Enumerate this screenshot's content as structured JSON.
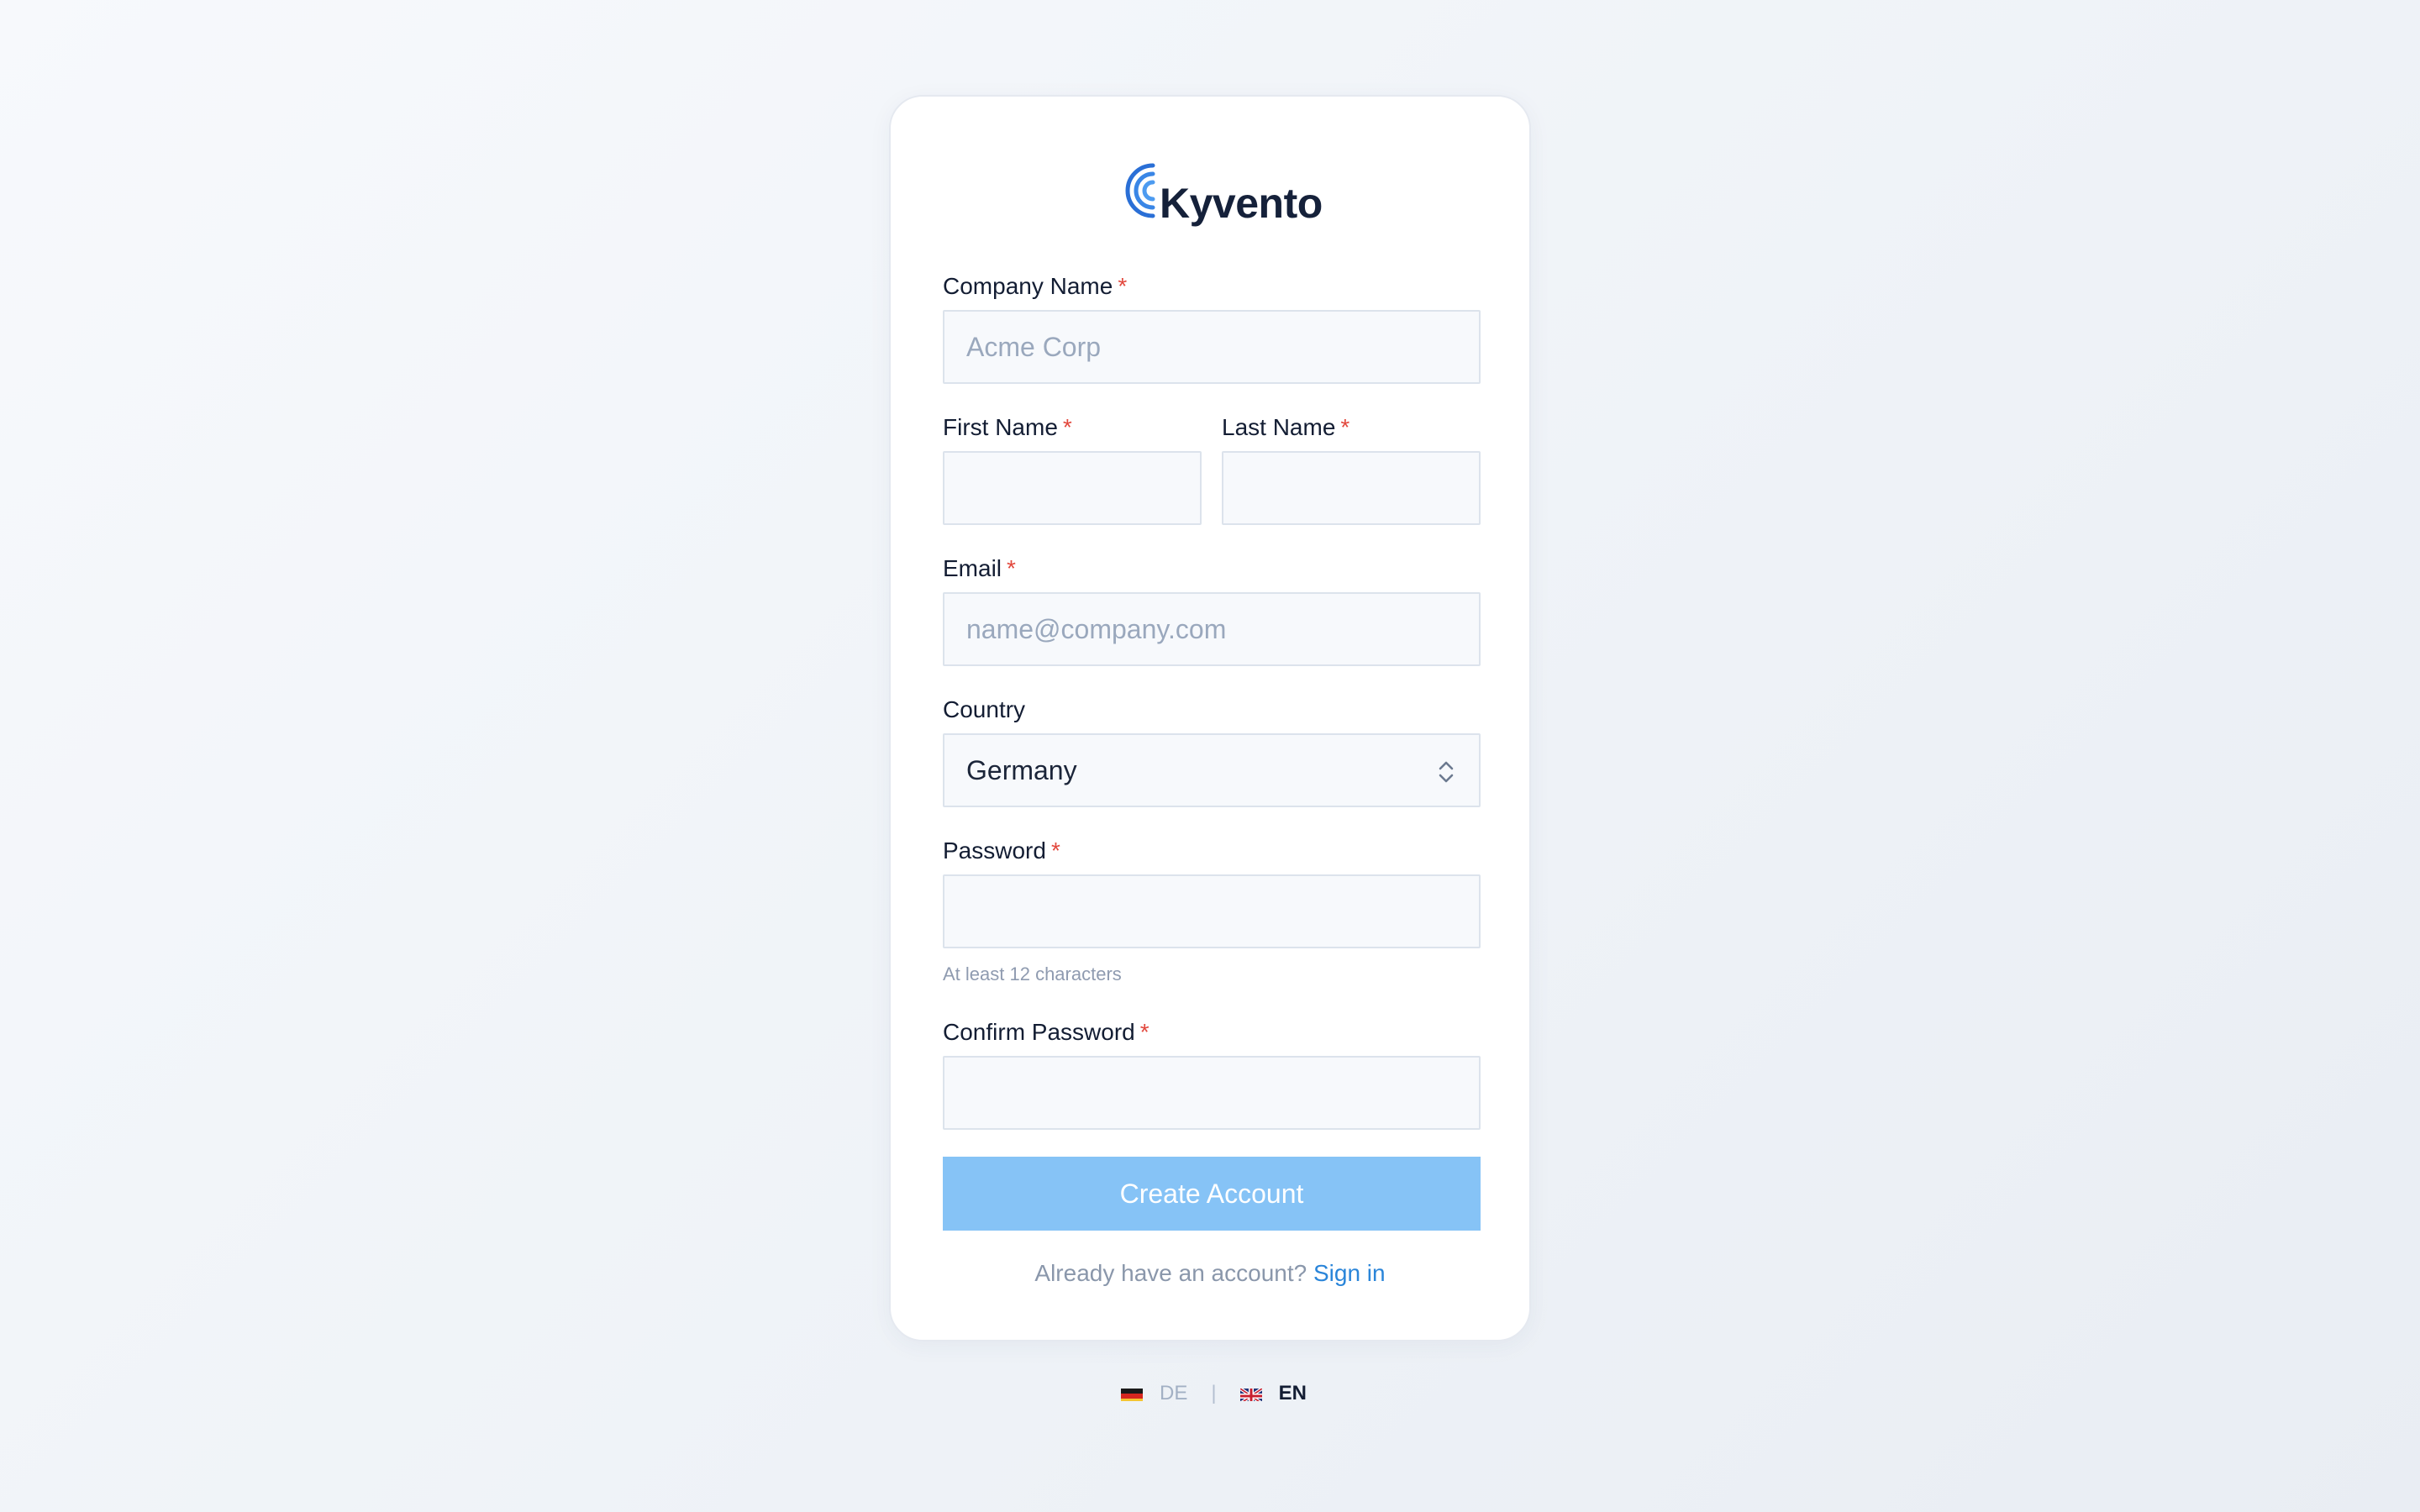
{
  "brand": {
    "name": "Kyvento",
    "accent_color": "#2a6fd6"
  },
  "form": {
    "company": {
      "label": "Company Name",
      "required_mark": "*",
      "placeholder": "Acme Corp",
      "value": ""
    },
    "first_name": {
      "label": "First Name",
      "required_mark": "*",
      "value": ""
    },
    "last_name": {
      "label": "Last Name",
      "required_mark": "*",
      "value": ""
    },
    "email": {
      "label": "Email",
      "required_mark": "*",
      "placeholder": "name@company.com",
      "value": ""
    },
    "country": {
      "label": "Country",
      "selected": "Germany",
      "icon": "chevron-updown-icon"
    },
    "password": {
      "label": "Password",
      "required_mark": "*",
      "value": "",
      "hint": "At least 12 characters"
    },
    "confirm_password": {
      "label": "Confirm Password",
      "required_mark": "*",
      "value": ""
    },
    "submit": {
      "label": "Create Account",
      "color": "#86c3f6"
    },
    "signin": {
      "prompt": "Already have an account?",
      "link": "Sign in",
      "link_color": "#2a85d9"
    }
  },
  "language": {
    "de": {
      "label": "DE",
      "flag": "germany-flag-icon"
    },
    "separator": "|",
    "en": {
      "label": "EN",
      "flag": "uk-flag-icon",
      "active": true
    }
  },
  "colors": {
    "required": "#e2483d",
    "input_bg": "#f7f9fc",
    "input_border": "#dce3ec"
  }
}
